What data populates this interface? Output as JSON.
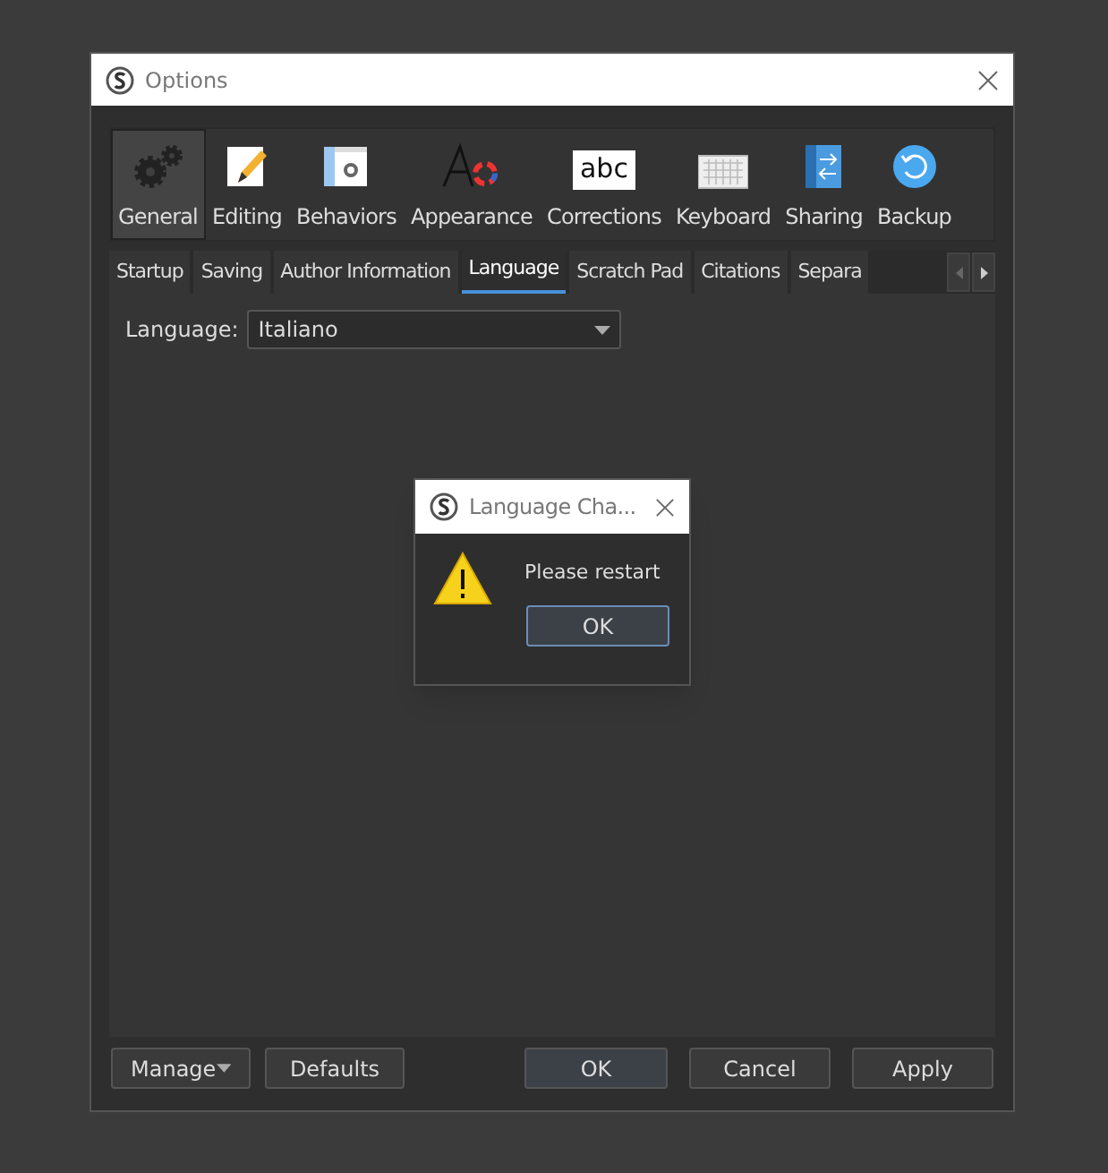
{
  "window": {
    "title": "Options"
  },
  "toolbar": [
    {
      "label": "General",
      "kind": "gears",
      "selected": true
    },
    {
      "label": "Editing",
      "kind": "pencil",
      "selected": false
    },
    {
      "label": "Behaviors",
      "kind": "window",
      "selected": false
    },
    {
      "label": "Appearance",
      "kind": "font",
      "selected": false
    },
    {
      "label": "Corrections",
      "kind": "abc",
      "icon_text": "abc",
      "selected": false
    },
    {
      "label": "Keyboard",
      "kind": "keyboard",
      "selected": false
    },
    {
      "label": "Sharing",
      "kind": "sharing",
      "selected": false
    },
    {
      "label": "Backup",
      "kind": "backup",
      "selected": false
    }
  ],
  "tabs": [
    {
      "label": "Startup",
      "selected": false
    },
    {
      "label": "Saving",
      "selected": false
    },
    {
      "label": "Author Information",
      "selected": false
    },
    {
      "label": "Language",
      "selected": true
    },
    {
      "label": "Scratch Pad",
      "selected": false
    },
    {
      "label": "Citations",
      "selected": false
    },
    {
      "label": "Separa",
      "selected": false
    }
  ],
  "language": {
    "label": "Language:",
    "value": "Italiano"
  },
  "message_box": {
    "title": "Language Cha...",
    "text": "Please restart",
    "button": "OK"
  },
  "buttons": {
    "manage": "Manage",
    "defaults": "Defaults",
    "ok": "OK",
    "cancel": "Cancel",
    "apply": "Apply"
  }
}
